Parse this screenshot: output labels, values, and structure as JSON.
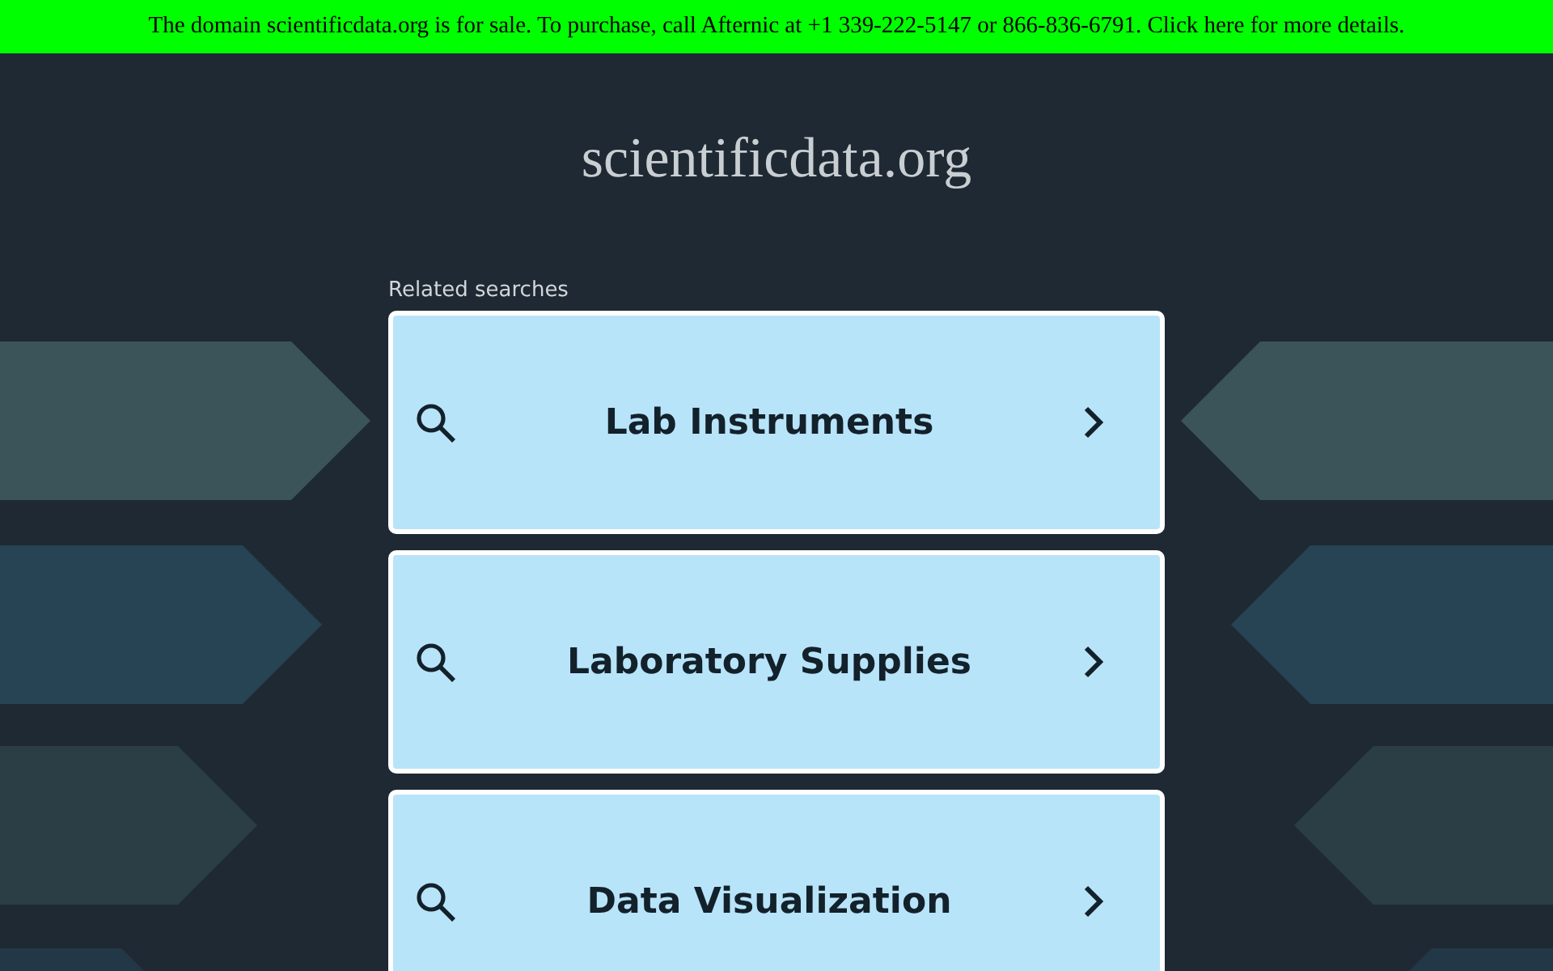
{
  "banner": {
    "text": "The domain scientificdata.org is for sale. To purchase, call Afternic at +1 339-222-5147 or 866-836-6791. Click here for more details."
  },
  "site_title": "scientificdata.org",
  "related": {
    "heading": "Related searches",
    "items": [
      {
        "label": "Lab Instruments"
      },
      {
        "label": "Laboratory Supplies"
      },
      {
        "label": "Data Visualization"
      }
    ]
  }
}
